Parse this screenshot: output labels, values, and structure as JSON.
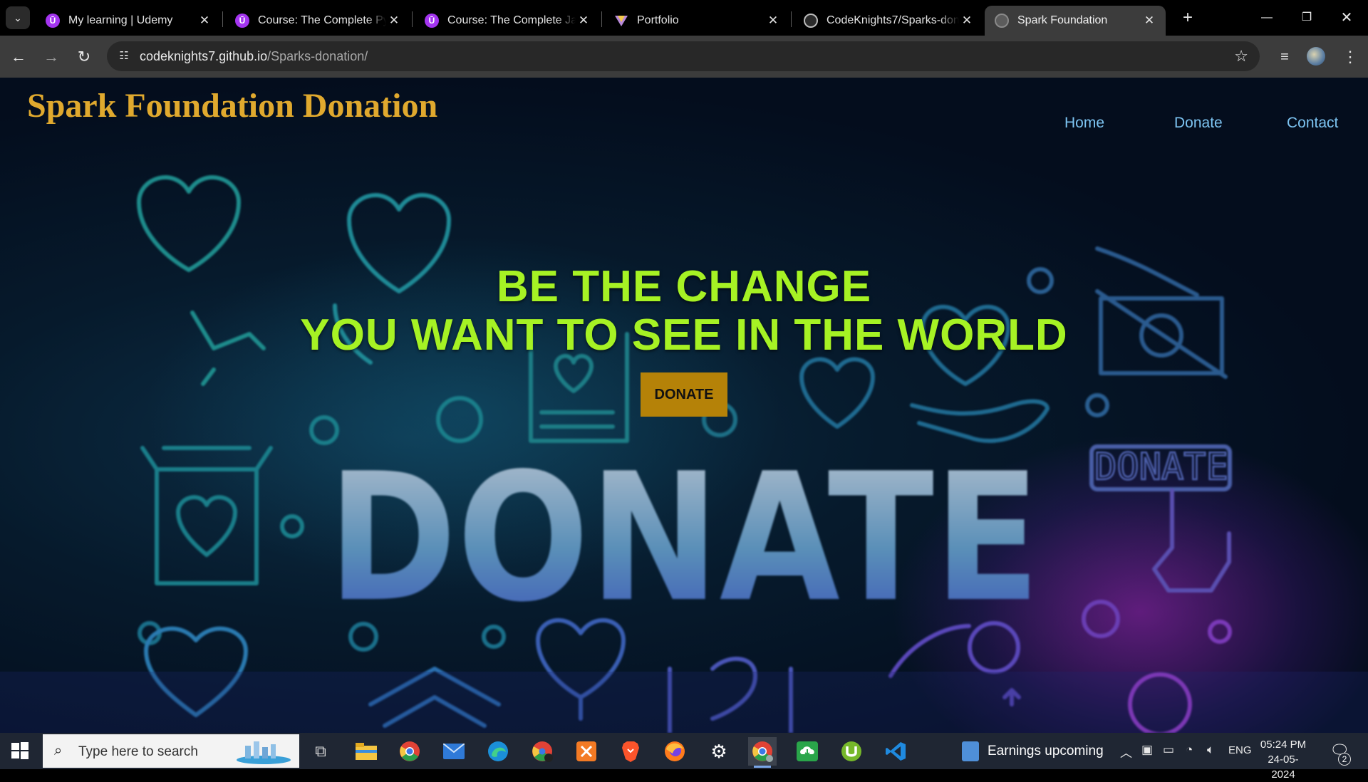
{
  "browser": {
    "tabs": [
      {
        "title": "My learning | Udemy",
        "icon": "udemy-icon"
      },
      {
        "title": "Course: The Complete Pyth",
        "icon": "udemy-icon"
      },
      {
        "title": "Course: The Complete Java",
        "icon": "udemy-icon"
      },
      {
        "title": "Portfolio",
        "icon": "portfolio-icon"
      },
      {
        "title": "CodeKnights7/Sparks-don",
        "icon": "github-icon"
      },
      {
        "title": "Spark Foundation",
        "icon": "globe-icon",
        "active": true
      }
    ],
    "url_host": "codeknights7.github.io",
    "url_path": "/Sparks-donation/"
  },
  "site": {
    "title": "Spark Foundation Donation",
    "nav": {
      "home": "Home",
      "donate": "Donate",
      "contact": "Contact"
    },
    "hero": {
      "line1": "BE THE CHANGE",
      "line2": "YOU WANT TO SEE IN THE WORLD",
      "button": "DONATE"
    },
    "background": {
      "big_word": "DONATE",
      "badge_word": "DONATE"
    },
    "colors": {
      "title": "#e0a92e",
      "hero_text": "#a6f224",
      "button_bg": "#b58208",
      "nav_link": "#7dc4f2"
    }
  },
  "taskbar": {
    "search_placeholder": "Type here to search",
    "news": "Earnings upcoming",
    "language": "ENG",
    "time": "05:24 PM",
    "date": "24-05-2024",
    "notification_count": "2"
  }
}
